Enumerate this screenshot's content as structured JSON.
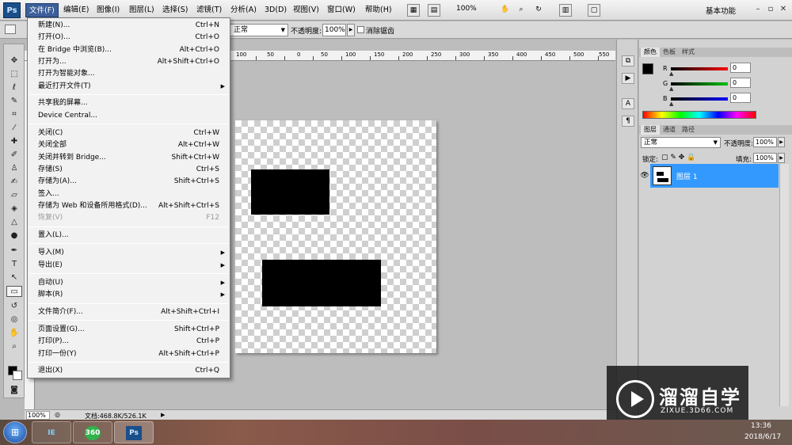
{
  "menubar": {
    "logo": "Ps",
    "items": [
      "文件(F)",
      "编辑(E)",
      "图像(I)",
      "图层(L)",
      "选择(S)",
      "滤镜(T)",
      "分析(A)",
      "3D(D)",
      "视图(V)",
      "窗口(W)",
      "帮助(H)"
    ],
    "zoom": "100%",
    "workspace": "基本功能"
  },
  "options": {
    "mode": "正常",
    "opacity_label": "不透明度:",
    "opacity_value": "100%",
    "antialias_label": "消除锯齿"
  },
  "ruler_numbers": [
    "100",
    "50",
    "0",
    "50",
    "100",
    "150",
    "200",
    "250",
    "300",
    "350",
    "400",
    "450",
    "500",
    "550",
    "600",
    "650"
  ],
  "file_menu": {
    "items": [
      {
        "label": "新建(N)...",
        "shortcut": "Ctrl+N"
      },
      {
        "label": "打开(O)...",
        "shortcut": "Ctrl+O"
      },
      {
        "label": "在 Bridge 中浏览(B)...",
        "shortcut": "Alt+Ctrl+O"
      },
      {
        "label": "打开为...",
        "shortcut": "Alt+Shift+Ctrl+O"
      },
      {
        "label": "打开为智能对象...",
        "shortcut": ""
      },
      {
        "label": "最近打开文件(T)",
        "shortcut": ""
      },
      {
        "label": "共享我的屏幕...",
        "shortcut": ""
      },
      {
        "label": "Device Central...",
        "shortcut": ""
      },
      {
        "label": "关闭(C)",
        "shortcut": "Ctrl+W"
      },
      {
        "label": "关闭全部",
        "shortcut": "Alt+Ctrl+W"
      },
      {
        "label": "关闭并转到 Bridge...",
        "shortcut": "Shift+Ctrl+W"
      },
      {
        "label": "存储(S)",
        "shortcut": "Ctrl+S"
      },
      {
        "label": "存储为(A)...",
        "shortcut": "Shift+Ctrl+S"
      },
      {
        "label": "签入...",
        "shortcut": ""
      },
      {
        "label": "存储为 Web 和设备所用格式(D)...",
        "shortcut": "Alt+Shift+Ctrl+S"
      },
      {
        "label": "恢复(V)",
        "shortcut": "F12"
      },
      {
        "label": "置入(L)...",
        "shortcut": ""
      },
      {
        "label": "导入(M)",
        "shortcut": ""
      },
      {
        "label": "导出(E)",
        "shortcut": ""
      },
      {
        "label": "自动(U)",
        "shortcut": ""
      },
      {
        "label": "脚本(R)",
        "shortcut": ""
      },
      {
        "label": "文件简介(F)...",
        "shortcut": "Alt+Shift+Ctrl+I"
      },
      {
        "label": "页面设置(G)...",
        "shortcut": "Shift+Ctrl+P"
      },
      {
        "label": "打印(P)...",
        "shortcut": "Ctrl+P"
      },
      {
        "label": "打印一份(Y)",
        "shortcut": "Alt+Shift+Ctrl+P"
      },
      {
        "label": "退出(X)",
        "shortcut": "Ctrl+Q"
      }
    ]
  },
  "color_panel": {
    "tabs": [
      "颜色",
      "色板",
      "样式"
    ],
    "channels": [
      {
        "label": "R",
        "value": "0",
        "color": "#ff0000"
      },
      {
        "label": "G",
        "value": "0",
        "color": "#00c000"
      },
      {
        "label": "B",
        "value": "0",
        "color": "#0000ff"
      }
    ]
  },
  "layers_panel": {
    "tabs": [
      "图层",
      "通道",
      "路径"
    ],
    "blend_mode": "正常",
    "opacity_label": "不透明度:",
    "opacity_value": "100%",
    "lock_label": "锁定:",
    "fill_label": "填充:",
    "fill_value": "100%",
    "layer_name": "图层 1"
  },
  "statusbar": {
    "zoom": "100%",
    "doc_size": "文档:468.8K/526.1K"
  },
  "watermark": {
    "title": "溜溜自学",
    "url": "ZIXUE.3D66.COM"
  },
  "taskbar": {
    "time": "13:36",
    "date": "2018/6/17",
    "apps": [
      "IE",
      "360",
      "Ps"
    ]
  }
}
